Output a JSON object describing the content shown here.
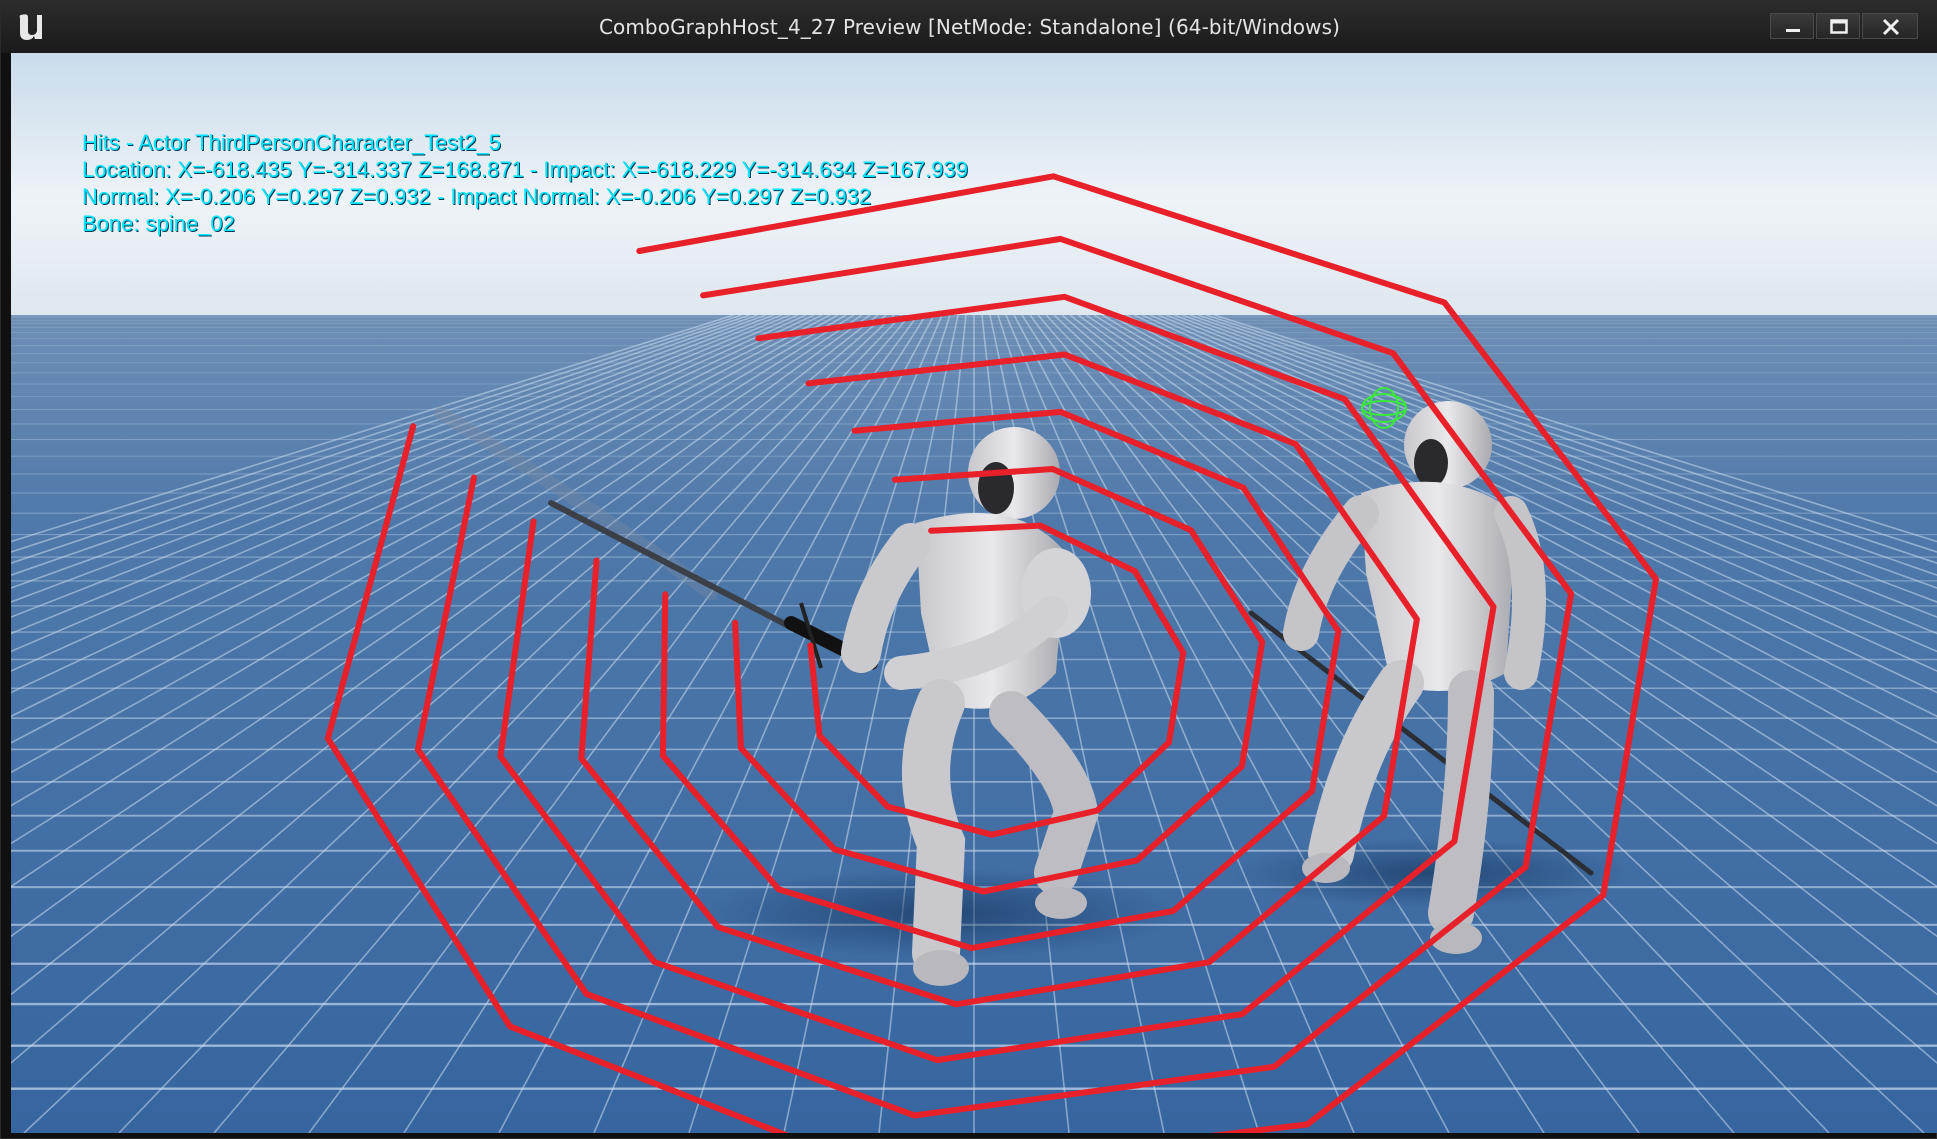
{
  "window": {
    "title": "ComboGraphHost_4_27 Preview [NetMode: Standalone]  (64-bit/Windows)",
    "controls": {
      "minimize_icon": "minimize-icon",
      "maximize_icon": "maximize-icon",
      "close_icon": "close-icon"
    }
  },
  "hud": {
    "line1": "Hits - Actor ThirdPersonCharacter_Test2_5",
    "line2": "Location: X=-618.435 Y=-314.337 Z=168.871 - Impact: X=-618.229 Y=-314.634 Z=167.939",
    "line3": "Normal: X=-0.206 Y=0.297 Z=0.932 - Impact Normal: X=-0.206 Y=0.297 Z=0.932",
    "line4": "Bone: spine_02",
    "color": "#00e5ff"
  },
  "scene": {
    "trace_color": "#e8202a",
    "hit_marker_color": "#39e83a",
    "sky_color": "#eef2f5",
    "floor_color": "#3a68a0"
  }
}
